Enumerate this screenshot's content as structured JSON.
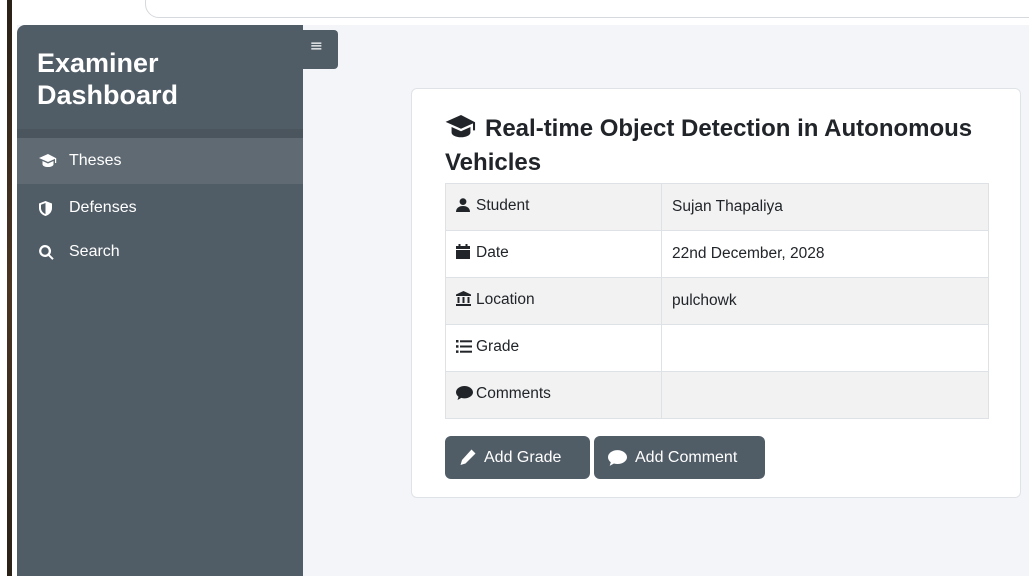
{
  "sidebar": {
    "title": "Examiner Dashboard",
    "items": [
      {
        "label": "Theses",
        "icon": "graduation-cap-icon",
        "active": true
      },
      {
        "label": "Defenses",
        "icon": "shield-icon",
        "active": false
      },
      {
        "label": "Search",
        "icon": "search-icon",
        "active": false
      }
    ]
  },
  "toggle": {
    "label": "≡"
  },
  "thesis": {
    "title": "Real-time Object Detection in Autonomous Vehicles",
    "fields": [
      {
        "label": "Student",
        "icon": "user-icon",
        "value": "Sujan Thapaliya"
      },
      {
        "label": "Date",
        "icon": "calendar-icon",
        "value": "22nd December, 2028"
      },
      {
        "label": "Location",
        "icon": "building-columns-icon",
        "value": "pulchowk"
      },
      {
        "label": "Grade",
        "icon": "list-icon",
        "value": ""
      },
      {
        "label": "Comments",
        "icon": "comment-icon",
        "value": ""
      }
    ]
  },
  "actions": {
    "add_grade": "Add Grade",
    "add_comment": "Add Comment"
  },
  "colors": {
    "sidebar_bg": "#505c66",
    "sidebar_active": "#5f6a73",
    "page_bg": "#f3f5f8",
    "button_bg": "#505c66"
  }
}
